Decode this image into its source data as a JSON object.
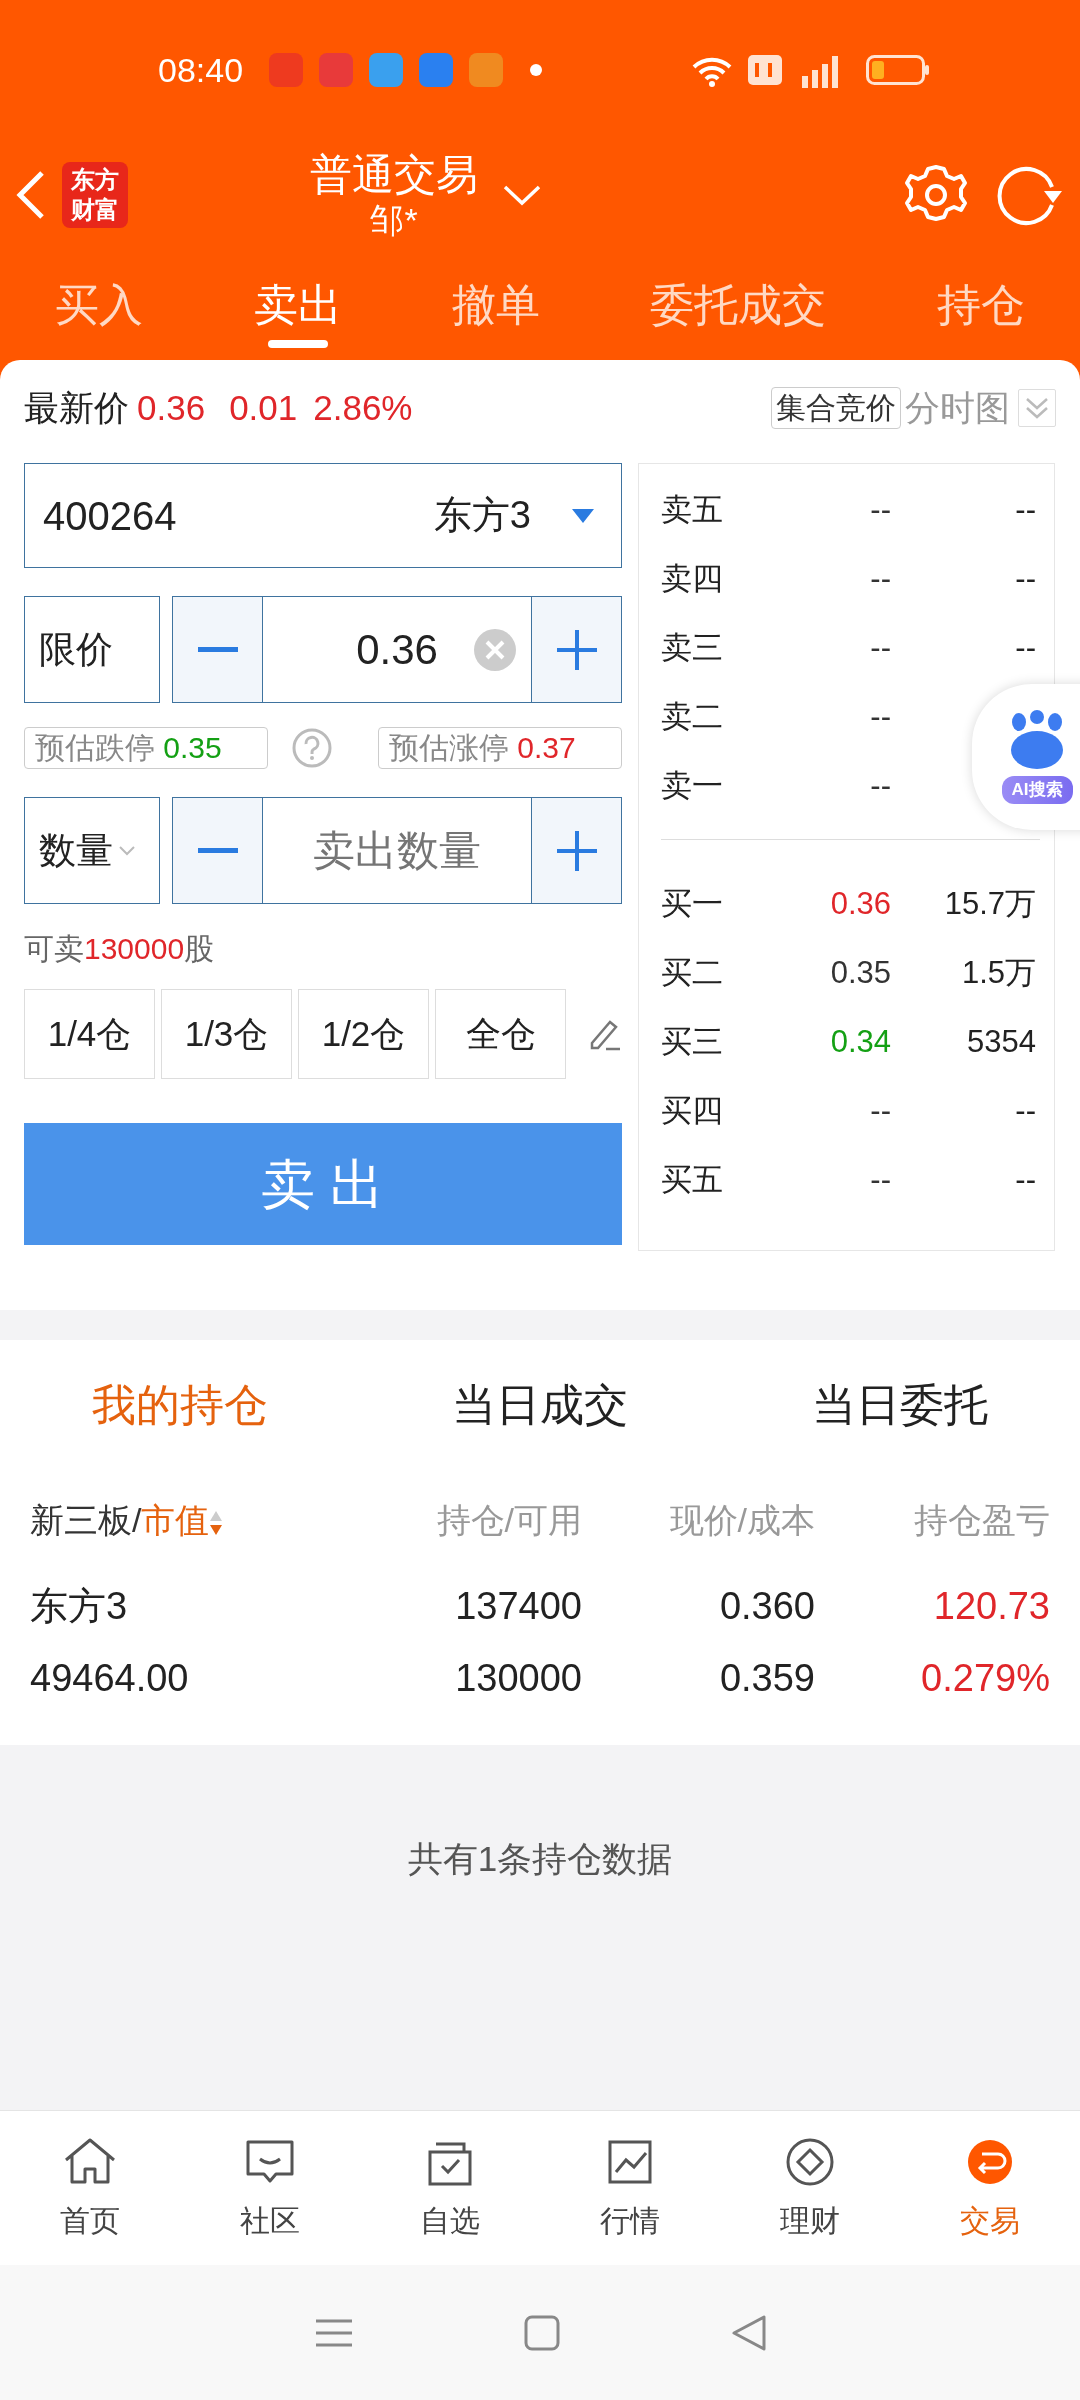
{
  "status_bar": {
    "time": "08:40"
  },
  "header": {
    "logo": "东方财富",
    "title": "普通交易",
    "subtitle": "邹*"
  },
  "tabs": [
    {
      "label": "买入",
      "selected": false
    },
    {
      "label": "卖出",
      "selected": true
    },
    {
      "label": "撤单",
      "selected": false
    },
    {
      "label": "委托成交",
      "selected": false
    },
    {
      "label": "持仓",
      "selected": false
    }
  ],
  "quote": {
    "label": "最新价",
    "price": "0.36",
    "change": "0.01",
    "percent": "2.86%",
    "auction_button": "集合竞价",
    "chart_button": "分时图"
  },
  "stock": {
    "code": "400264",
    "name": "东方3"
  },
  "price_row": {
    "type": "限价",
    "value": "0.36"
  },
  "limits": [
    {
      "label": "预估跌停",
      "value": "0.35",
      "kind": "down"
    },
    {
      "label": "预估涨停",
      "value": "0.37",
      "kind": "up"
    }
  ],
  "quantity": {
    "label": "数量",
    "placeholder": "卖出数量"
  },
  "available": {
    "prefix": "可卖",
    "amount": "130000",
    "suffix": "股"
  },
  "portions": [
    "1/4仓",
    "1/3仓",
    "1/2仓",
    "全仓"
  ],
  "submit": "卖 出",
  "order_book": {
    "asks": [
      {
        "label": "卖五",
        "price": "--",
        "volume": "--",
        "color": "#333333"
      },
      {
        "label": "卖四",
        "price": "--",
        "volume": "--",
        "color": "#333333"
      },
      {
        "label": "卖三",
        "price": "--",
        "volume": "--",
        "color": "#333333"
      },
      {
        "label": "卖二",
        "price": "--",
        "color": "#333333"
      },
      {
        "label": "卖一",
        "price": "--",
        "color": "#333333"
      }
    ],
    "bids": [
      {
        "label": "买一",
        "price": "0.36",
        "volume": "15.7万",
        "color": "#e0262a"
      },
      {
        "label": "买二",
        "price": "0.35",
        "volume": "1.5万",
        "color": "#333333"
      },
      {
        "label": "买三",
        "price": "0.34",
        "volume": "5354",
        "color": "#14a014"
      },
      {
        "label": "买四",
        "price": "--",
        "volume": "--",
        "color": "#333333"
      },
      {
        "label": "买五",
        "price": "--",
        "volume": "--",
        "color": "#333333"
      }
    ]
  },
  "ai_bubble": {
    "label": "AI搜索"
  },
  "holding_tabs": [
    {
      "label": "我的持仓",
      "selected": true
    },
    {
      "label": "当日成交",
      "selected": false
    },
    {
      "label": "当日委托",
      "selected": false
    }
  ],
  "holdings": {
    "columns": [
      {
        "label": "新三板/",
        "sort_label": "市值"
      },
      {
        "label": "持仓/可用"
      },
      {
        "label": "现价/成本"
      },
      {
        "label": "持仓盈亏"
      }
    ],
    "rows": [
      {
        "name": "东方3",
        "market_value": "49464.00",
        "holding": "137400",
        "available": "130000",
        "price": "0.360",
        "cost": "0.359",
        "pnl": "120.73",
        "pnl_percent": "0.279%"
      }
    ],
    "note": "共有1条持仓数据"
  },
  "bottom_nav": [
    {
      "label": "首页",
      "kind": "home",
      "selected": false
    },
    {
      "label": "社区",
      "kind": "community",
      "selected": false
    },
    {
      "label": "自选",
      "kind": "watchlist",
      "selected": false
    },
    {
      "label": "行情",
      "kind": "market",
      "selected": false
    },
    {
      "label": "理财",
      "kind": "wealth",
      "selected": false
    },
    {
      "label": "交易",
      "kind": "trade",
      "selected": true
    }
  ]
}
